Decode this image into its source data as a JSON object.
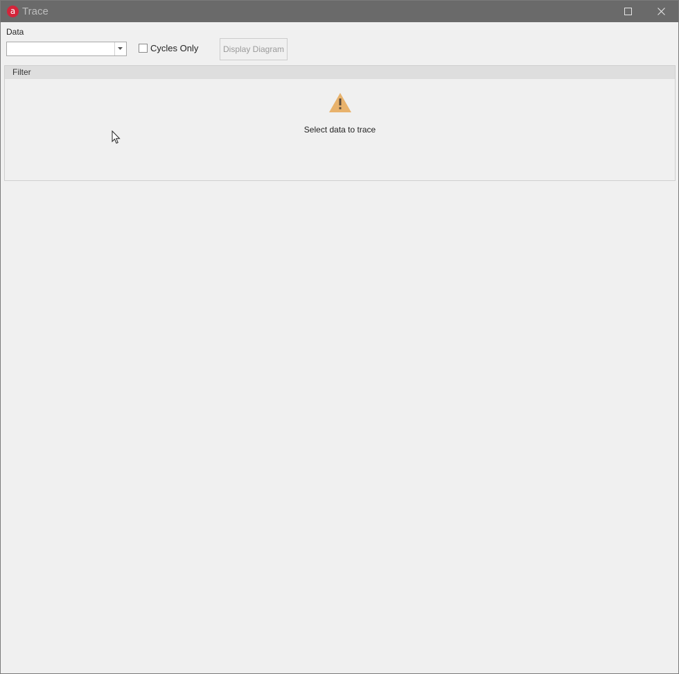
{
  "window": {
    "app_logo_letter": "a",
    "title": "Trace",
    "maximize_icon": "maximize-icon",
    "close_icon": "close-icon"
  },
  "toolbar": {
    "data_label": "Data",
    "data_combo_value": "",
    "cycles_only_label": "Cycles Only",
    "cycles_only_checked": false,
    "display_diagram_label": "Display Diagram",
    "display_diagram_enabled": false
  },
  "filter": {
    "title": "Filter",
    "warning_icon": "warning-icon",
    "empty_message": "Select data to trace"
  },
  "colors": {
    "titlebar": "#6a6a6a",
    "logo": "#d4243a",
    "warning": "#e8b26c"
  }
}
